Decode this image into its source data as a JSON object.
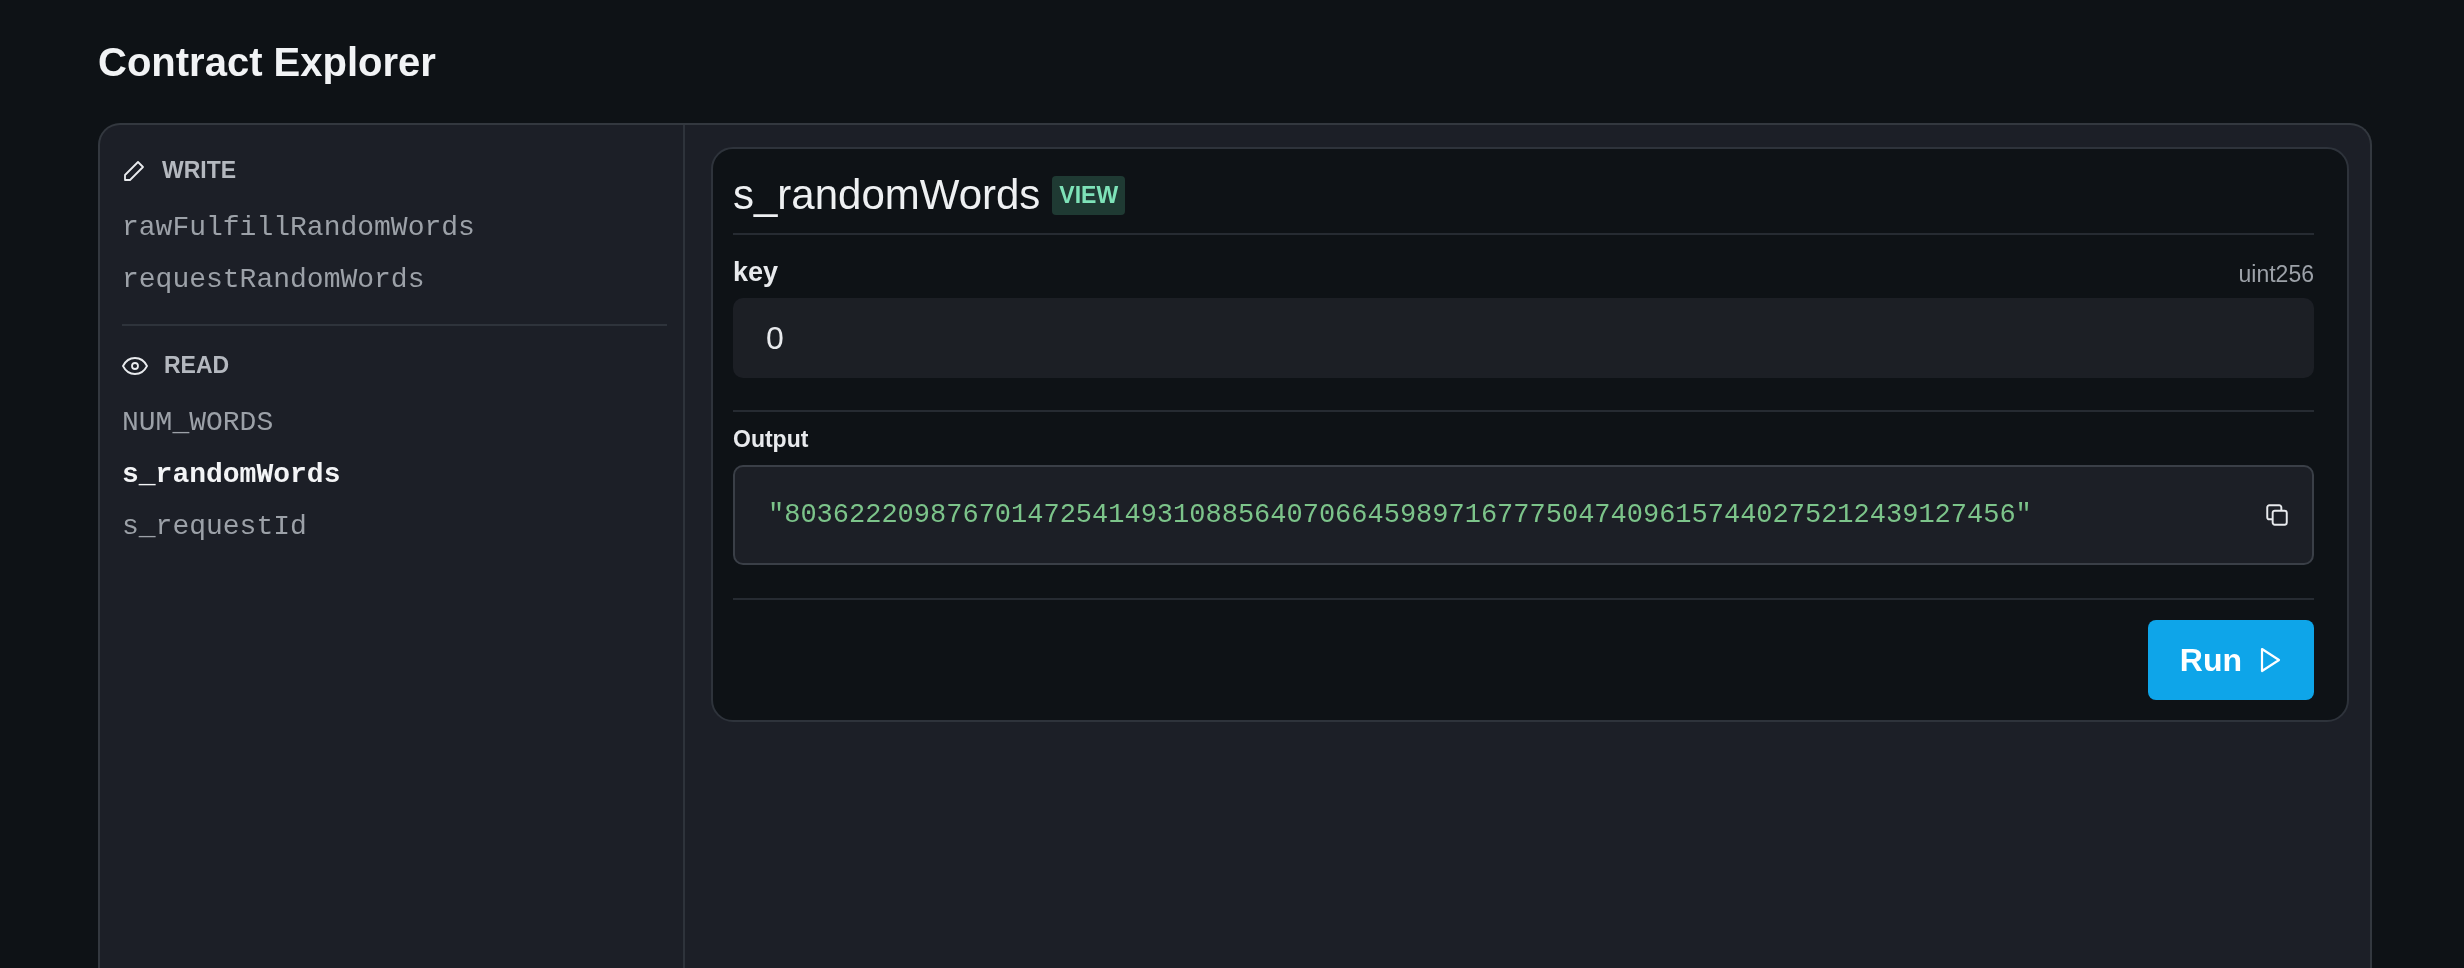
{
  "page_title": "Contract Explorer",
  "sidebar": {
    "sections": [
      {
        "kind": "write",
        "label": "WRITE",
        "items": [
          {
            "label": "rawFulfillRandomWords",
            "selected": false
          },
          {
            "label": "requestRandomWords",
            "selected": false
          }
        ]
      },
      {
        "kind": "read",
        "label": "READ",
        "items": [
          {
            "label": "NUM_WORDS",
            "selected": false
          },
          {
            "label": "s_randomWords",
            "selected": true
          },
          {
            "label": "s_requestId",
            "selected": false
          }
        ]
      }
    ]
  },
  "function_panel": {
    "name": "s_randomWords",
    "badge": "VIEW",
    "inputs": [
      {
        "label": "key",
        "type": "uint256",
        "value": "0"
      }
    ],
    "output_label": "Output",
    "output": "\"8036222098767014725414931088564070664598971677750474096157440275212439127456\"",
    "run_button": "Run"
  }
}
